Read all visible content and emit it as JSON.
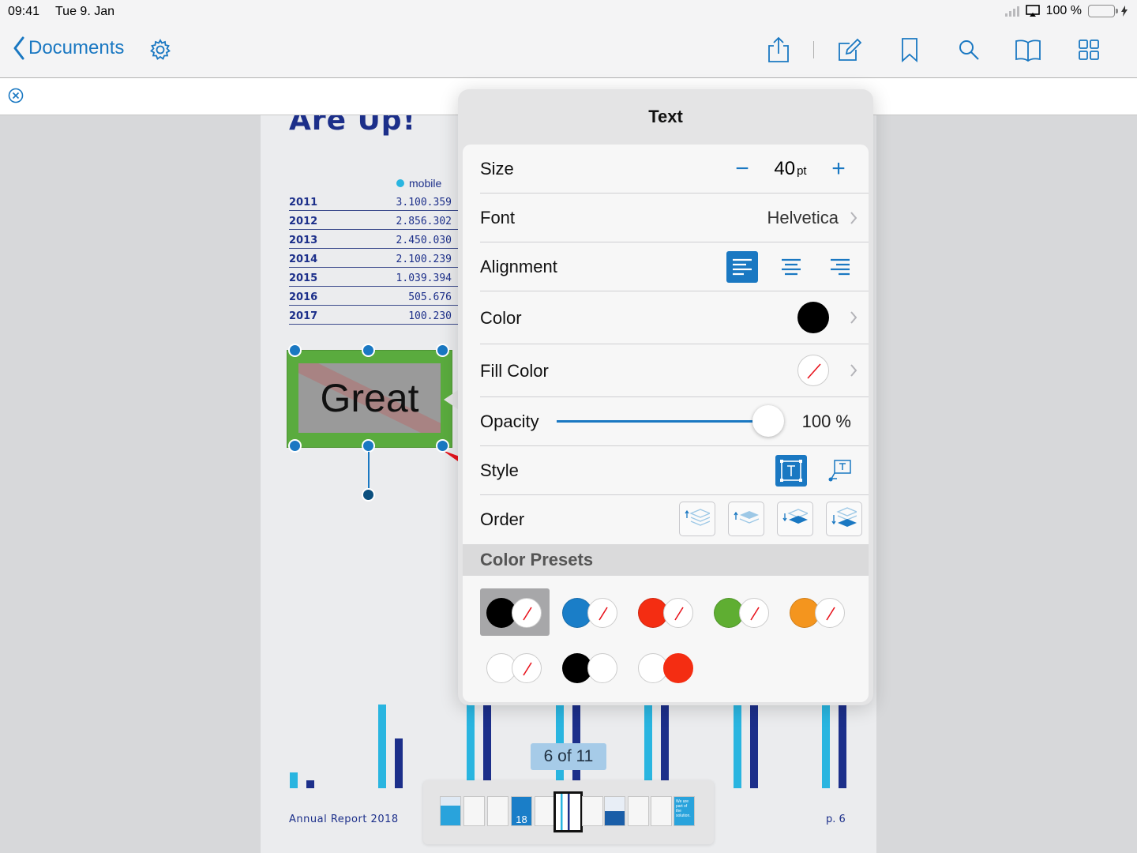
{
  "status_bar": {
    "time": "09:41",
    "date": "Tue 9. Jan",
    "battery": "100 %"
  },
  "navbar": {
    "back_label": "Documents",
    "icons": [
      "settings-icon",
      "share-icon",
      "edit-icon",
      "bookmark-icon",
      "search-icon",
      "book-icon",
      "grid-icon"
    ]
  },
  "page": {
    "title": "Are Up!",
    "legend": "mobile",
    "table": [
      {
        "year": "2011",
        "value": "3.100.359"
      },
      {
        "year": "2012",
        "value": "2.856.302"
      },
      {
        "year": "2013",
        "value": "2.450.030"
      },
      {
        "year": "2014",
        "value": "2.100.239"
      },
      {
        "year": "2015",
        "value": "1.039.394"
      },
      {
        "year": "2016",
        "value": "505.676"
      },
      {
        "year": "2017",
        "value": "100.230"
      }
    ],
    "footer_left": "Annual Report 2018",
    "footer_right": "p. 6",
    "colors": {
      "text": "#1c2f8a",
      "series_light": "#29b5e0",
      "series_dark": "#1c2f8a"
    }
  },
  "annotation": {
    "text": "Great",
    "fill": "#5aab3e"
  },
  "popover": {
    "title": "Text",
    "size": {
      "label": "Size",
      "value": "40",
      "unit": "pt",
      "minus": "−",
      "plus": "+"
    },
    "font": {
      "label": "Font",
      "value": "Helvetica"
    },
    "alignment": {
      "label": "Alignment",
      "selected": "left"
    },
    "color": {
      "label": "Color",
      "value": "#000000"
    },
    "fill_color": {
      "label": "Fill Color"
    },
    "opacity": {
      "label": "Opacity",
      "value": "100 %",
      "fraction": 1.0
    },
    "style": {
      "label": "Style"
    },
    "order": {
      "label": "Order"
    },
    "presets_title": "Color Presets",
    "presets": [
      {
        "color": "#000000",
        "fill": "none",
        "selected": true
      },
      {
        "color": "#1a7ec8",
        "fill": "none"
      },
      {
        "color": "#f42d12",
        "fill": "none"
      },
      {
        "color": "#5fae32",
        "fill": "none"
      },
      {
        "color": "#f4951e",
        "fill": "none"
      },
      {
        "color": "#ffffff",
        "fill": "none"
      },
      {
        "color": "#000000",
        "fill": "#ffffff"
      },
      {
        "color": "#ffffff",
        "fill": "#f42d12"
      }
    ],
    "accent": "#1a78c2"
  },
  "page_counter": "6 of 11",
  "thumbnail_label": "18",
  "thumbnail_text": "We are part of the solution."
}
